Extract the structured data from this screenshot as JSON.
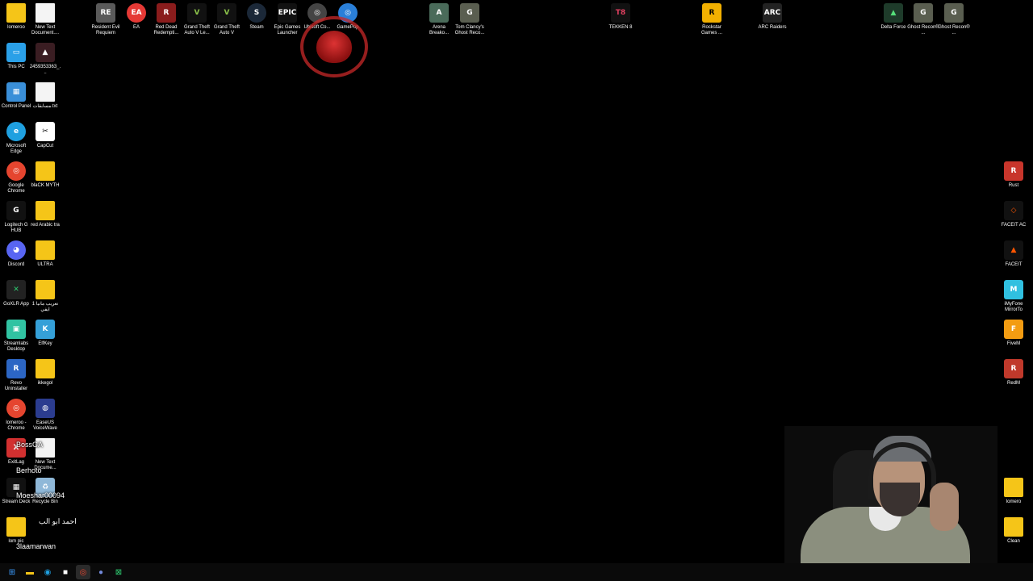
{
  "desktop": {
    "icons_left": [
      {
        "label": "lomeroo",
        "type": "folder"
      },
      {
        "label": "New Text Document....",
        "type": "doc"
      },
      {
        "label": "This PC",
        "type": "thispc"
      },
      {
        "label": "2459353363_...",
        "type": "file-dark"
      },
      {
        "label": "Control Panel",
        "type": "control"
      },
      {
        "label": "مسابقات.txt",
        "type": "doc"
      },
      {
        "label": "Microsoft Edge",
        "type": "edge"
      },
      {
        "label": "CapCut",
        "type": "capcut"
      },
      {
        "label": "Google Chrome",
        "type": "chrome"
      },
      {
        "label": "blaCK MYTH",
        "type": "folder"
      },
      {
        "label": "Logitech G HUB",
        "type": "logitech"
      },
      {
        "label": "red Arabic tra",
        "type": "folder"
      },
      {
        "label": "Discord",
        "type": "discord"
      },
      {
        "label": "ULTRA",
        "type": "folder"
      },
      {
        "label": "GoXLR App",
        "type": "goxlr"
      },
      {
        "label": "تعريب مانيا 1 ايفي",
        "type": "folder"
      },
      {
        "label": "Streamlabs Desktop",
        "type": "streamlabs"
      },
      {
        "label": "ElfKey",
        "type": "elfkey"
      },
      {
        "label": "Revo Uninstaller",
        "type": "revo"
      },
      {
        "label": "ikkegol",
        "type": "folder"
      },
      {
        "label": "lomeroo - Chrome",
        "type": "chrome"
      },
      {
        "label": "EaseUS VoiceWave",
        "type": "easeus"
      },
      {
        "label": "ExitLag",
        "type": "exitlag"
      },
      {
        "label": "New Text Docume...",
        "type": "doc"
      },
      {
        "label": "Stream Deck",
        "type": "streamdeck"
      },
      {
        "label": "Recycle Bin",
        "type": "recycle"
      },
      {
        "label": "lom pic",
        "type": "folder"
      }
    ],
    "icons_top": [
      {
        "label": "Resident Evil Requiem",
        "type": "re"
      },
      {
        "label": "EA",
        "type": "ea"
      },
      {
        "label": "Red Dead Redempti...",
        "type": "rdr"
      },
      {
        "label": "Grand Theft Auto V Le...",
        "type": "gta"
      },
      {
        "label": "Grand Theft Auto V",
        "type": "gta"
      },
      {
        "label": "Steam",
        "type": "steam"
      },
      {
        "label": "Epic Games Launcher",
        "type": "epic"
      },
      {
        "label": "Ubisoft Co...",
        "type": "ubisoft"
      },
      {
        "label": "GamePop",
        "type": "gamepop"
      },
      {
        "label": "Arena Breako...",
        "type": "arena"
      },
      {
        "label": "Tom Clancy's Ghost Reco...",
        "type": "ghost"
      },
      {
        "label": "TEKKEN 8",
        "type": "tekken"
      },
      {
        "label": "Rockstar Games ...",
        "type": "rockstar"
      },
      {
        "label": "ARC Raiders",
        "type": "arc"
      },
      {
        "label": "Delta Force",
        "type": "delta"
      },
      {
        "label": "Ghost Recon® ...",
        "type": "ghost"
      },
      {
        "label": "Ghost Recon® ...",
        "type": "ghost"
      }
    ],
    "icons_right": [
      {
        "label": "Rust",
        "type": "rust"
      },
      {
        "label": "FACEIT AC",
        "type": "faceitac"
      },
      {
        "label": "FACEIT",
        "type": "faceit"
      },
      {
        "label": "iMyFone MirrorTo",
        "type": "imyfone"
      },
      {
        "label": "FiveM",
        "type": "fivem"
      },
      {
        "label": "RedM",
        "type": "redm"
      },
      {
        "label": "lomero",
        "type": "folder"
      },
      {
        "label": "Clean",
        "type": "folder"
      }
    ]
  },
  "chat_overlay": [
    {
      "name": "BossGA",
      "color": "#ffffff"
    },
    {
      "name": "Berhoto",
      "color": "#ffffff"
    },
    {
      "name": "Moeshar00094",
      "color": "#ffffff"
    },
    {
      "name": "احمد ابو الب",
      "color": "#ffffff"
    },
    {
      "name": "3laamarwan",
      "color": "#ffffff"
    }
  ],
  "taskbar": {
    "items": [
      {
        "icon": "windows-start-icon",
        "glyph": "⊞",
        "color": "#3b9cff",
        "active": false
      },
      {
        "icon": "file-explorer-icon",
        "glyph": "▬",
        "color": "#f5c518",
        "active": false
      },
      {
        "icon": "edge-icon",
        "glyph": "◉",
        "color": "#1fa0e0",
        "active": false
      },
      {
        "icon": "store-icon",
        "glyph": "■",
        "color": "#ffffff",
        "active": false
      },
      {
        "icon": "chrome-icon",
        "glyph": "◎",
        "color": "#e5452f",
        "active": true
      },
      {
        "icon": "discord-icon",
        "glyph": "●",
        "color": "#7289da",
        "active": false
      },
      {
        "icon": "goxlr-icon",
        "glyph": "⊠",
        "color": "#2ecc71",
        "active": false
      }
    ]
  },
  "colors": {
    "background": "#000000",
    "folder": "#f5c518",
    "overlay_logo_red": "#c82828"
  }
}
